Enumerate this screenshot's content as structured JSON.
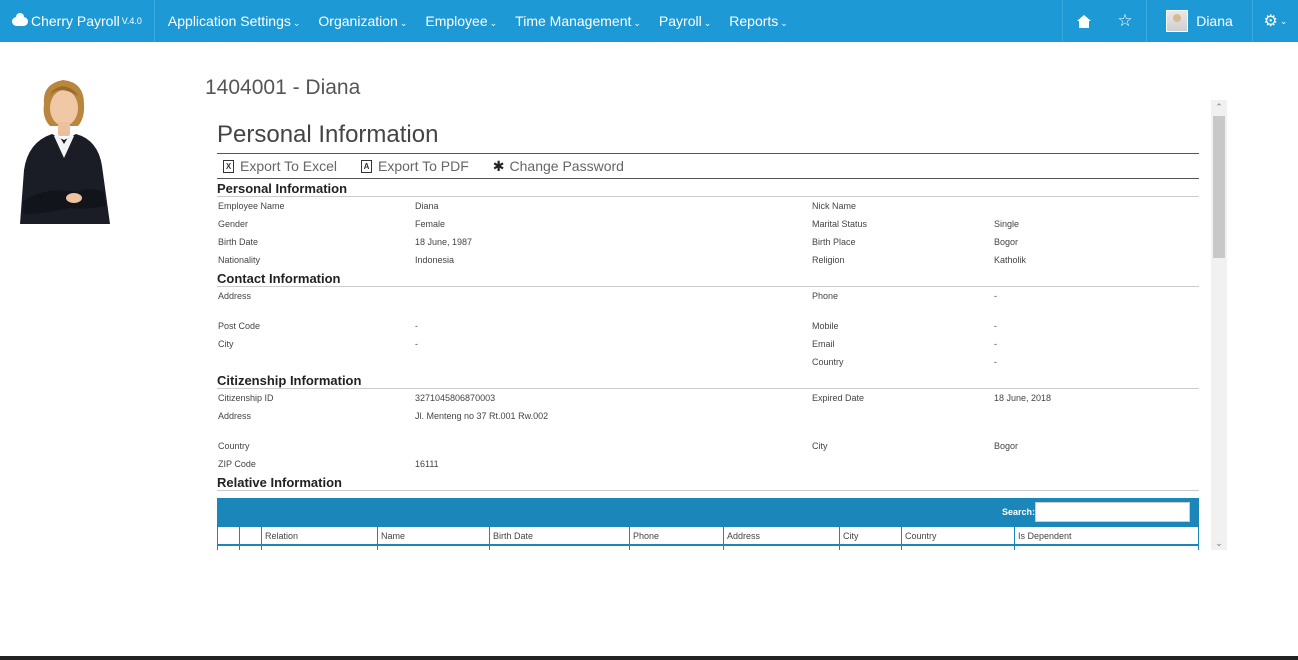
{
  "app": {
    "name": "Cherry Payroll",
    "version": "V.4.0"
  },
  "nav": {
    "menu": [
      {
        "label": "Application Settings"
      },
      {
        "label": "Organization"
      },
      {
        "label": "Employee"
      },
      {
        "label": "Time Management"
      },
      {
        "label": "Payroll"
      },
      {
        "label": "Reports"
      }
    ],
    "icons": [
      "home-icon",
      "star-icon",
      "gear-icon"
    ],
    "user": "Diana"
  },
  "employee": {
    "title": "1404001 - Diana"
  },
  "page": {
    "section_title": "Personal Information",
    "toolbar": {
      "excel": "Export To Excel",
      "pdf": "Export To PDF",
      "password": "Change Password"
    }
  },
  "personal": {
    "title": "Personal Information",
    "rows": [
      [
        "Employee Name",
        "Diana",
        "Nick Name",
        ""
      ],
      [
        "Gender",
        "Female",
        "Marital Status",
        "Single"
      ],
      [
        "Birth Date",
        "18 June, 1987",
        "Birth Place",
        "Bogor"
      ],
      [
        "Nationality",
        "Indonesia",
        "Religion",
        "Katholik"
      ]
    ]
  },
  "contact": {
    "title": "Contact Information",
    "rows": [
      [
        "Address",
        "",
        "Phone",
        "-"
      ],
      [
        "",
        "",
        "",
        ""
      ],
      [
        "Post Code",
        "-",
        "Mobile",
        "-"
      ],
      [
        "City",
        "-",
        "Email",
        "-"
      ],
      [
        "",
        "",
        "Country",
        "-"
      ]
    ]
  },
  "citizenship": {
    "title": "Citizenship Information",
    "rows": [
      [
        "Citizenship ID",
        "3271045806870003",
        "Expired Date",
        "18 June, 2018"
      ],
      [
        "Address",
        "Jl. Menteng no 37 Rt.001 Rw.002",
        "",
        ""
      ],
      [
        "",
        "",
        "",
        ""
      ],
      [
        "Country",
        "",
        "City",
        "Bogor"
      ],
      [
        "ZIP Code",
        "16111",
        "",
        ""
      ]
    ]
  },
  "relative": {
    "title": "Relative Information",
    "search_label": "Search:",
    "columns": [
      "",
      "",
      "Relation",
      "Name",
      "Birth Date",
      "Phone",
      "Address",
      "City",
      "Country",
      "Is Dependent"
    ]
  }
}
